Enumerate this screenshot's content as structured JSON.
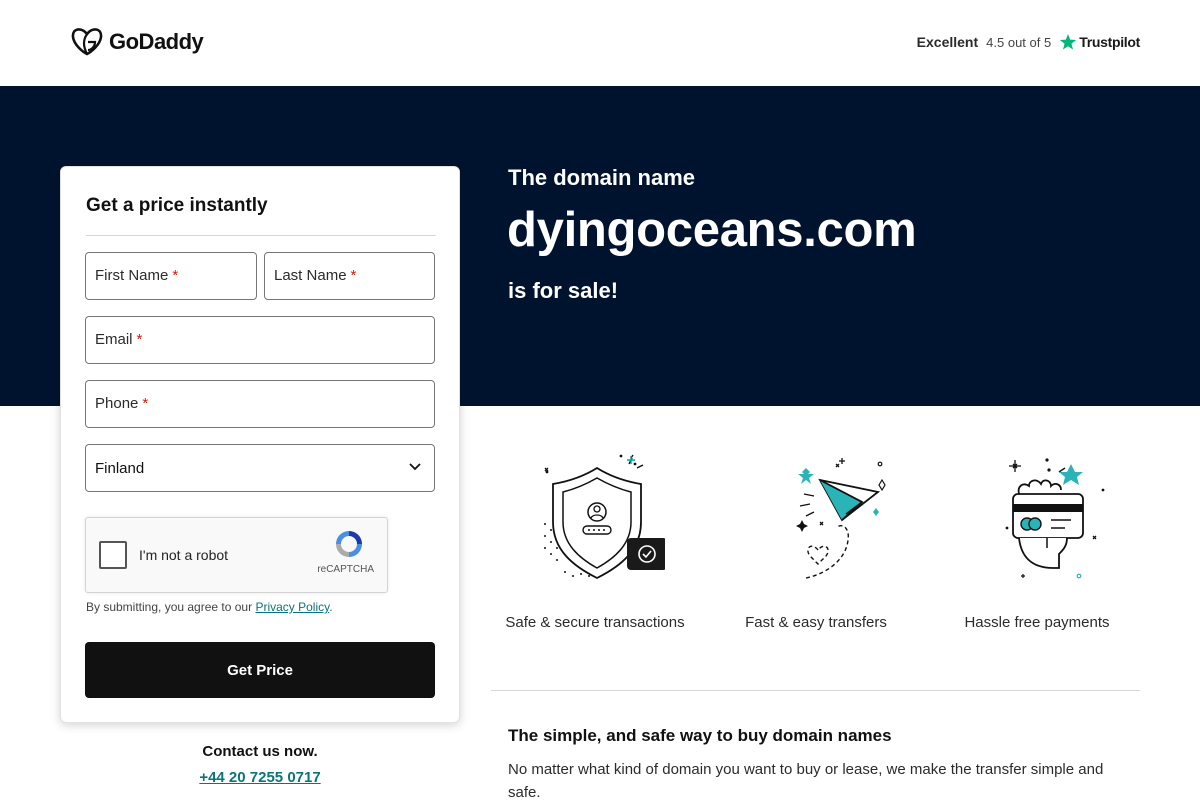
{
  "header": {
    "logo_text": "GoDaddy",
    "trust": {
      "rating_label": "Excellent",
      "score_text": "4.5 out of 5",
      "brand": "Trustpilot"
    }
  },
  "hero": {
    "pre_text": "The domain name",
    "domain": "dyingoceans.com",
    "post_text": "is for sale!"
  },
  "form": {
    "title": "Get a price instantly",
    "first_name_label": "First Name",
    "last_name_label": "Last Name",
    "email_label": "Email",
    "phone_label": "Phone",
    "required_mark": "*",
    "country_selected": "Finland",
    "captcha_text": "I'm not a robot",
    "captcha_brand": "reCAPTCHA",
    "consent_prefix": "By submitting, you agree to our ",
    "consent_link": "Privacy Policy",
    "consent_suffix": ".",
    "submit_label": "Get Price"
  },
  "contact": {
    "label": "Contact us now.",
    "phone": "+44 20 7255 0717"
  },
  "features": [
    {
      "icon": "shield-icon",
      "label": "Safe & secure transactions"
    },
    {
      "icon": "paper-plane-icon",
      "label": "Fast & easy transfers"
    },
    {
      "icon": "card-payment-icon",
      "label": "Hassle free payments"
    }
  ],
  "info": {
    "title": "The simple, and safe way to buy domain names",
    "body": "No matter what kind of domain you want to buy or lease, we make the transfer simple and safe."
  },
  "colors": {
    "hero_bg": "#00132e",
    "button_bg": "#111111",
    "link": "#09757a",
    "required": "#db1802",
    "trustpilot_green": "#00b67a"
  }
}
